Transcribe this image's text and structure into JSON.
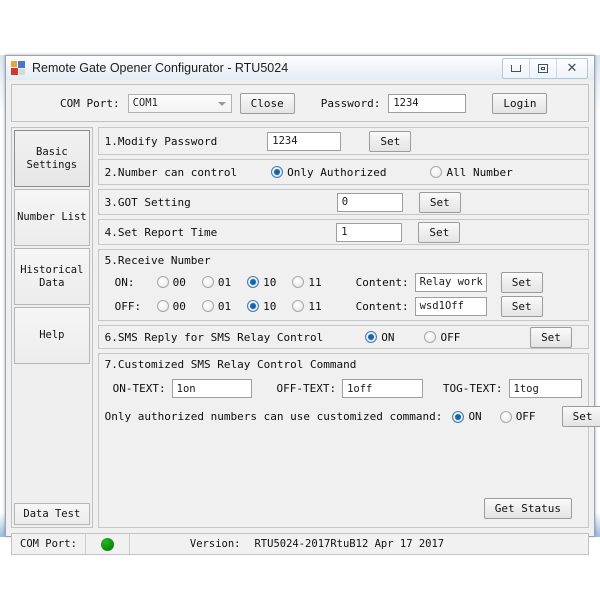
{
  "window": {
    "title": "Remote Gate Opener Configurator - RTU5024",
    "app_icon": "app-squares-icon",
    "minimize_label": "",
    "maximize_label": "",
    "close_label": "✕"
  },
  "topbar": {
    "com_port_label": "COM Port:",
    "com_port_value": "COM1",
    "close_button": "Close",
    "password_label": "Password:",
    "password_value": "1234",
    "login_button": "Login"
  },
  "sidebar": {
    "items": [
      {
        "label": "Basic Settings",
        "active": true
      },
      {
        "label": "Number List",
        "active": false
      },
      {
        "label": "Historical\nData",
        "active": false
      },
      {
        "label": "Help",
        "active": false
      }
    ],
    "historical_line1": "Historical",
    "historical_line2": "Data",
    "bottom_item": "Data Test"
  },
  "sections": {
    "s1": {
      "title": "1.Modify Password",
      "value": "1234",
      "set_button": "Set"
    },
    "s2": {
      "title": "2.Number can control",
      "option_authorized": "Only Authorized",
      "option_all": "All Number",
      "selected": "Only Authorized"
    },
    "s3": {
      "title": "3.GOT Setting",
      "value": "0",
      "set_button": "Set"
    },
    "s4": {
      "title": "4.Set Report Time",
      "value": "1",
      "set_button": "Set"
    },
    "s5": {
      "title": "5.Receive Number",
      "on_label": "ON:",
      "off_label": "OFF:",
      "options": [
        "00",
        "01",
        "10",
        "11"
      ],
      "on_selected": "10",
      "off_selected": "10",
      "content_label": "Content:",
      "on_content": "Relay work",
      "off_content": "wsd1Off",
      "set_button": "Set"
    },
    "s6": {
      "title": "6.SMS Reply for SMS Relay Control",
      "on_label": "ON",
      "off_label": "OFF",
      "selected": "ON",
      "set_button": "Set"
    },
    "s7": {
      "title": "7.Customized SMS Relay Control Command",
      "on_text_label": "ON-TEXT:",
      "on_text_value": "1on",
      "off_text_label": "OFF-TEXT:",
      "off_text_value": "1off",
      "tog_text_label": "TOG-TEXT:",
      "tog_text_value": "1tog",
      "auth_label": "Only authorized numbers can use customized command:",
      "auth_on": "ON",
      "auth_off": "OFF",
      "auth_selected": "ON",
      "set_button": "Set",
      "get_status_button": "Get Status"
    }
  },
  "statusbar": {
    "com_port_label": "COM Port:",
    "led_color": "#0a8a0a",
    "version_label": "Version:",
    "version_value": "RTU5024-2017RtuB12 Apr 17 2017"
  }
}
